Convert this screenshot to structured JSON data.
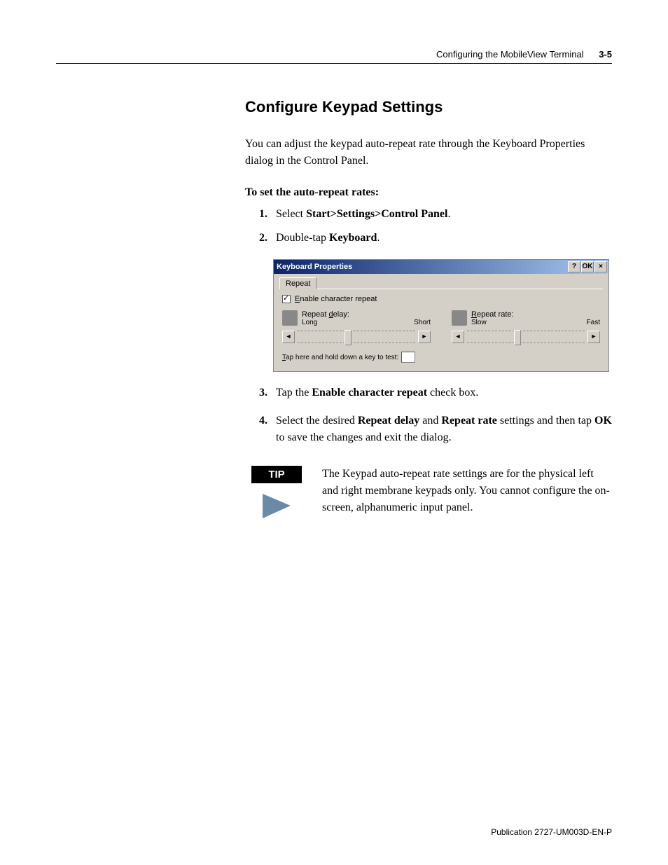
{
  "header": {
    "chapter": "Configuring the MobileView Terminal",
    "page": "3-5"
  },
  "section": {
    "title": "Configure Keypad Settings",
    "intro": "You can adjust the keypad auto-repeat rate through the Keyboard Properties dialog in the Control Panel.",
    "procedure_label": "To set the auto-repeat rates:",
    "steps": {
      "s1_prefix": "Select ",
      "s1_bold": "Start>Settings>Control Panel",
      "s1_suffix": ".",
      "s2_prefix": "Double-tap ",
      "s2_bold": "Keyboard",
      "s2_suffix": ".",
      "s3_prefix": "Tap the ",
      "s3_bold": "Enable character repeat",
      "s3_suffix": " check box.",
      "s4_prefix": "Select the desired ",
      "s4_bold1": "Repeat delay",
      "s4_mid": " and ",
      "s4_bold2": "Repeat rate",
      "s4_mid2": " settings and then tap ",
      "s4_bold3": "OK",
      "s4_suffix": " to save the changes and exit the dialog."
    }
  },
  "dialog": {
    "title": "Keyboard Properties",
    "help": "?",
    "ok": "OK",
    "close": "×",
    "tab": "Repeat",
    "enable_prefix": "E",
    "enable_text": "nable character repeat",
    "delay_prefix": "Repeat ",
    "delay_u": "d",
    "delay_suffix": "elay:",
    "delay_left": "Long",
    "delay_right": "Short",
    "rate_u": "R",
    "rate_suffix": "epeat rate:",
    "rate_left": "Slow",
    "rate_right": "Fast",
    "test_u": "T",
    "test_text": "ap here and hold down a key to test:",
    "arrow_left": "◄",
    "arrow_right": "►"
  },
  "tip": {
    "badge": "TIP",
    "text": "The Keypad auto-repeat rate settings are for the physical left and right membrane keypads only. You cannot configure the on-screen, alphanumeric input panel."
  },
  "footer": {
    "pub": "Publication 2727-UM003D-EN-P"
  }
}
